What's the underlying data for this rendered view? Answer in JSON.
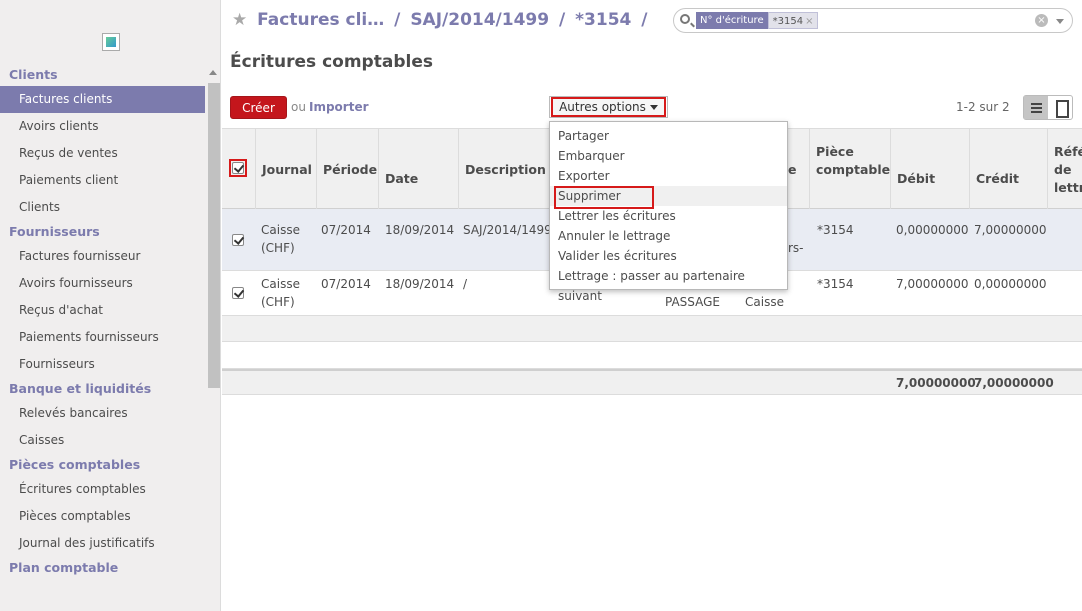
{
  "breadcrumb": {
    "items": [
      "Factures cli…",
      "SAJ/2014/1499",
      "*3154"
    ],
    "separator": "/"
  },
  "page_title": "Écritures comptables",
  "search": {
    "facet_label": "N° d'écriture",
    "facet_value": "*3154",
    "facet_remove": "×",
    "clear": "×"
  },
  "sidebar": {
    "sections": [
      {
        "title": "Clients",
        "items": [
          "Factures clients",
          "Avoirs clients",
          "Reçus de ventes",
          "Paiements client",
          "Clients"
        ]
      },
      {
        "title": "Fournisseurs",
        "items": [
          "Factures fournisseur",
          "Avoirs fournisseurs",
          "Reçus d'achat",
          "Paiements fournisseurs",
          "Fournisseurs"
        ]
      },
      {
        "title": "Banque et liquidités",
        "items": [
          "Relevés bancaires",
          "Caisses"
        ]
      },
      {
        "title": "Pièces comptables",
        "items": [
          "Écritures comptables",
          "Pièces comptables",
          "Journal des justificatifs"
        ]
      },
      {
        "title": "Plan comptable",
        "items": []
      }
    ],
    "active_item": "Factures clients"
  },
  "toolbar": {
    "create": "Créer",
    "or": "ou",
    "import": "Importer",
    "more_options": "Autres options",
    "pager": "1-2 sur 2"
  },
  "dropdown": {
    "items": [
      "Partager",
      "Embarquer",
      "Exporter",
      "Supprimer",
      "Lettrer les écritures",
      "Annuler le lettrage",
      "Valider les écritures",
      "Lettrage : passer au partenaire suivant"
    ],
    "highlighted": "Supprimer"
  },
  "table": {
    "headers": {
      "journal": "Journal",
      "periode": "Période",
      "date": "Date",
      "description": "Description",
      "partial_e": "e",
      "piece": "Pièce comptable",
      "debit": "Débit",
      "credit": "Crédit",
      "ref": "Réfé de lettr"
    },
    "rows": [
      {
        "journal": "Caisse (CHF)",
        "periode": "07/2014",
        "date": "18/09/2014",
        "description": "SAJ/2014/1499",
        "partial": "rs-",
        "piece": "*3154",
        "debit": "0,00000000",
        "credit": "7,00000000"
      },
      {
        "journal": "Caisse (CHF)",
        "periode": "07/2014",
        "date": "18/09/2014",
        "description": "/",
        "partner": "PASSAGE",
        "account": "Caisse",
        "piece": "*3154",
        "debit": "7,00000000",
        "credit": "0,00000000"
      }
    ],
    "totals": {
      "debit": "7,00000000",
      "credit": "7,00000000"
    }
  }
}
